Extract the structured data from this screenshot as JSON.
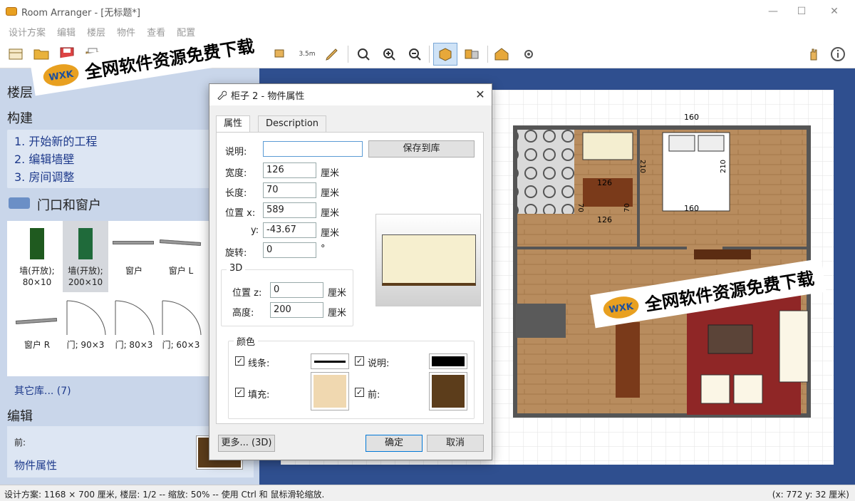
{
  "window": {
    "title": "Room Arranger - [无标题*]",
    "minimize": "—",
    "maximize": "☐",
    "close": "✕"
  },
  "menu": [
    "设计方案",
    "编辑",
    "楼层",
    "物件",
    "查看",
    "配置"
  ],
  "toolbar": {
    "ruler_label": "3.5m"
  },
  "left": {
    "floors_head": "楼层",
    "build_head": "构建",
    "steps": [
      "1. 开始新的工程",
      "2. 编辑墙壁",
      "3. 房间调整"
    ],
    "doors_head": "门口和窗户",
    "palette": [
      {
        "label": "墙(开放);\n80×10"
      },
      {
        "label": "墙(开放);\n200×10"
      },
      {
        "label": "窗户"
      },
      {
        "label": "窗户 L"
      },
      {
        "label": "窗户 R"
      },
      {
        "label": "门; 90×3"
      },
      {
        "label": "门; 80×3"
      },
      {
        "label": "门; 60×3"
      }
    ],
    "more_library": "其它库... (7)",
    "edit_head": "编辑",
    "front_label": "前:",
    "obj_props_link": "物件属性"
  },
  "dialog": {
    "title": "柜子 2 - 物件属性",
    "tabs": [
      "属性",
      "Description"
    ],
    "desc_label": "说明:",
    "desc_value": "",
    "save_lib": "保存到库",
    "width_label": "宽度:",
    "width_value": "126",
    "length_label": "长度:",
    "length_value": "70",
    "pos_label": "位置  x:",
    "x_value": "589",
    "y_label": "y:",
    "y_value": "-43.67",
    "rot_label": "旋转:",
    "rot_value": "0",
    "deg": "°",
    "unit": "厘米",
    "group_3d": "3D",
    "z_label": "位置  z:",
    "z_value": "0",
    "height_label": "高度:",
    "height_value": "200",
    "group_color": "颜色",
    "line_label": "线条:",
    "desc_color_label": "说明:",
    "fill_label": "填充:",
    "front_color_label": "前:",
    "more3d": "更多... (3D)",
    "ok": "确定",
    "cancel": "取消",
    "colors": {
      "line": "#000000",
      "desc": "#000000",
      "fill": "#f0d8b0",
      "front": "#5c3d1b"
    }
  },
  "plan": {
    "dims": [
      "160",
      "210",
      "210",
      "160",
      "126",
      "70",
      "70",
      "126"
    ]
  },
  "watermark": {
    "text": "全网软件资源免费下载",
    "logo": "WXK"
  },
  "status": {
    "left": "设计方案: 1168 × 700 厘米, 楼层: 1/2 -- 缩放: 50% -- 使用 Ctrl 和 鼠标滑轮缩放.",
    "right": "(x: 772 y: 32 厘米)"
  }
}
